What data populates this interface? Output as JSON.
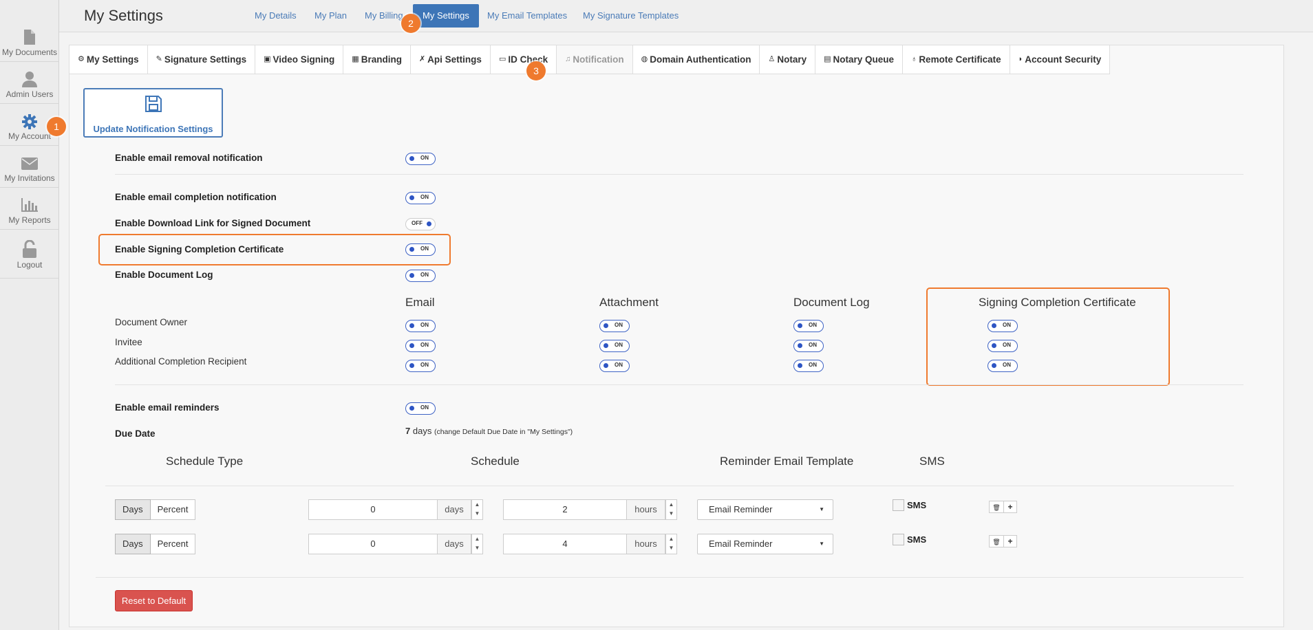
{
  "sidebar": {
    "items": [
      {
        "label": "My Documents",
        "icon": "document-icon"
      },
      {
        "label": "Admin Users",
        "icon": "user-icon"
      },
      {
        "label": "My Account",
        "icon": "gear-icon",
        "active": true
      },
      {
        "label": "My Invitations",
        "icon": "envelope-icon"
      },
      {
        "label": "My Reports",
        "icon": "bar-chart-icon"
      },
      {
        "label": "Logout",
        "icon": "unlock-icon"
      }
    ]
  },
  "header": {
    "title": "My Settings",
    "tabs": [
      "My Details",
      "My Plan",
      "My Billing",
      "My Settings",
      "My Email Templates",
      "My Signature Templates"
    ],
    "active_tab": "My Settings"
  },
  "badges": [
    "1",
    "2",
    "3"
  ],
  "subtabs": [
    {
      "label": "My Settings",
      "icon": "⚙"
    },
    {
      "label": "Signature Settings",
      "icon": "✎"
    },
    {
      "label": "Video Signing",
      "icon": "▣"
    },
    {
      "label": "Branding",
      "icon": "▦"
    },
    {
      "label": "Api Settings",
      "icon": "✗"
    },
    {
      "label": "ID Check",
      "icon": "▭"
    },
    {
      "label": "Notification",
      "icon": "♫"
    },
    {
      "label": "Domain Authentication",
      "icon": "◍"
    },
    {
      "label": "Notary",
      "icon": "♙"
    },
    {
      "label": "Notary Queue",
      "icon": "▤"
    },
    {
      "label": "Remote Certificate",
      "icon": "♁"
    },
    {
      "label": "Account Security",
      "icon": "◗"
    }
  ],
  "active_subtab": "Notification",
  "update_button": "Update Notification Settings",
  "settings": [
    {
      "label": "Enable email removal notification",
      "state": "ON"
    },
    {
      "label": "Enable email completion notification",
      "state": "ON"
    },
    {
      "label": "Enable Download Link for Signed Document",
      "state": "OFF"
    },
    {
      "label": "Enable Signing Completion Certificate",
      "state": "ON"
    },
    {
      "label": "Enable Document Log",
      "state": "ON"
    }
  ],
  "matrix": {
    "columns": [
      "Email",
      "Attachment",
      "Document Log",
      "Signing Completion Certificate"
    ],
    "rows": [
      {
        "label": "Document Owner",
        "values": [
          "ON",
          "ON",
          "ON",
          "ON"
        ]
      },
      {
        "label": "Invitee",
        "values": [
          "ON",
          "ON",
          "ON",
          "ON"
        ]
      },
      {
        "label": "Additional Completion Recipient",
        "values": [
          "ON",
          "ON",
          "ON",
          "ON"
        ]
      }
    ]
  },
  "reminders": {
    "label": "Enable email reminders",
    "state": "ON",
    "due_date_label": "Due Date",
    "due_date_value": "7",
    "due_date_unit": "days",
    "due_date_note": "(change Default Due Date in \"My Settings\")"
  },
  "schedule": {
    "headers": [
      "Schedule Type",
      "Schedule",
      "Reminder Email Template",
      "SMS"
    ],
    "rows": [
      {
        "type_options": [
          "Days",
          "Percent"
        ],
        "selected": "Days",
        "days": "0",
        "days_unit": "days",
        "hours": "2",
        "hours_unit": "hours",
        "template": "Email Reminder",
        "sms_label": "SMS",
        "sms_checked": false
      },
      {
        "type_options": [
          "Days",
          "Percent"
        ],
        "selected": "Days",
        "days": "0",
        "days_unit": "days",
        "hours": "4",
        "hours_unit": "hours",
        "template": "Email Reminder",
        "sms_label": "SMS",
        "sms_checked": false
      }
    ]
  },
  "reset_button": "Reset to Default",
  "colors": {
    "accent": "#3d75b7",
    "highlight": "#ef7a2e",
    "danger": "#d9534f"
  }
}
